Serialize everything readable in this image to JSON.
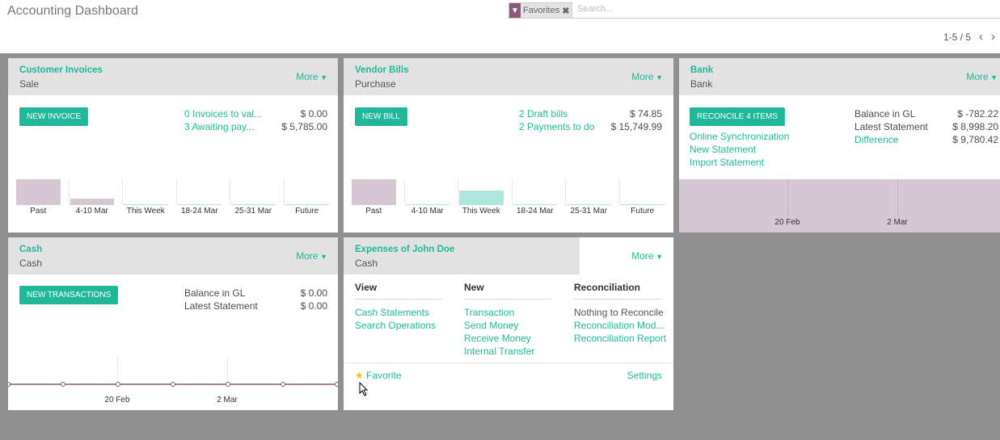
{
  "header": {
    "title": "Accounting Dashboard",
    "facet_label": "Favorites",
    "search_placeholder": "Search...",
    "pager": "1-5 / 5"
  },
  "common": {
    "more_label": "More"
  },
  "customer_invoices": {
    "title": "Customer Invoices",
    "subtitle": "Sale",
    "button": "NEW INVOICE",
    "rows": [
      {
        "label": "0 Invoices to val...",
        "amount": "$ 0.00"
      },
      {
        "label": "3 Awaiting pay...",
        "amount": "$ 5,785.00"
      }
    ]
  },
  "vendor_bills": {
    "title": "Vendor Bills",
    "subtitle": "Purchase",
    "button": "NEW BILL",
    "rows": [
      {
        "label": "2 Draft bills",
        "amount": "$ 74.85"
      },
      {
        "label": "2 Payments to do",
        "amount": "$ 15,749.99"
      }
    ]
  },
  "bank": {
    "title": "Bank",
    "subtitle": "Bank",
    "button": "RECONCILE 4 ITEMS",
    "links": [
      "Online Synchronization",
      "New Statement",
      "Import Statement"
    ],
    "balances": [
      {
        "label": "Balance in GL",
        "amount": "$ -782.22"
      },
      {
        "label": "Latest Statement",
        "amount": "$ 8,998.20"
      },
      {
        "label": "Difference",
        "amount": "$ 9,780.42"
      }
    ],
    "x_ticks": [
      "20 Feb",
      "2 Mar"
    ]
  },
  "cash": {
    "title": "Cash",
    "subtitle": "Cash",
    "button": "NEW TRANSACTIONS",
    "balances": [
      {
        "label": "Balance in GL",
        "amount": "$ 0.00"
      },
      {
        "label": "Latest Statement",
        "amount": "$ 0.00"
      }
    ],
    "x_ticks": [
      "20 Feb",
      "2 Mar"
    ]
  },
  "expenses": {
    "title": "Expenses of John Doe",
    "subtitle": "Cash",
    "columns": [
      {
        "header": "View",
        "items": [
          "Cash Statements",
          "Search Operations"
        ]
      },
      {
        "header": "New",
        "items": [
          "Transaction",
          "Send Money",
          "Receive Money",
          "Internal Transfer"
        ]
      },
      {
        "header": "Reconciliation",
        "items": [
          "Nothing to Reconcile",
          "Reconciliation Mod...",
          "Reconciliation Report"
        ]
      }
    ],
    "favorite_label": "Favorite",
    "settings_label": "Settings"
  },
  "chart_data": [
    {
      "type": "bar",
      "categories": [
        "Past",
        "4-10 Mar",
        "This Week",
        "18-24 Mar",
        "25-31 Mar",
        "Future"
      ],
      "values": [
        5785,
        1500,
        0,
        0,
        0,
        0
      ],
      "colors": [
        "#d6c8d3",
        "#d6c8d3",
        "#d6c8d3",
        "#d6c8d3",
        "#d6c8d3",
        "#d6c8d3"
      ]
    },
    {
      "type": "bar",
      "categories": [
        "Past",
        "4-10 Mar",
        "This Week",
        "18-24 Mar",
        "25-31 Mar",
        "Future"
      ],
      "values": [
        15749.99,
        0,
        9000,
        0,
        0,
        0
      ],
      "colors": [
        "#d6c8d3",
        "#d6c8d3",
        "#aee6d9",
        "#d6c8d3",
        "#d6c8d3",
        "#d6c8d3"
      ]
    }
  ],
  "colors": {
    "accent": "#21b799",
    "brand": "#875a7b",
    "card_header": "#e2e2e2",
    "background": "#8f8f8f"
  }
}
